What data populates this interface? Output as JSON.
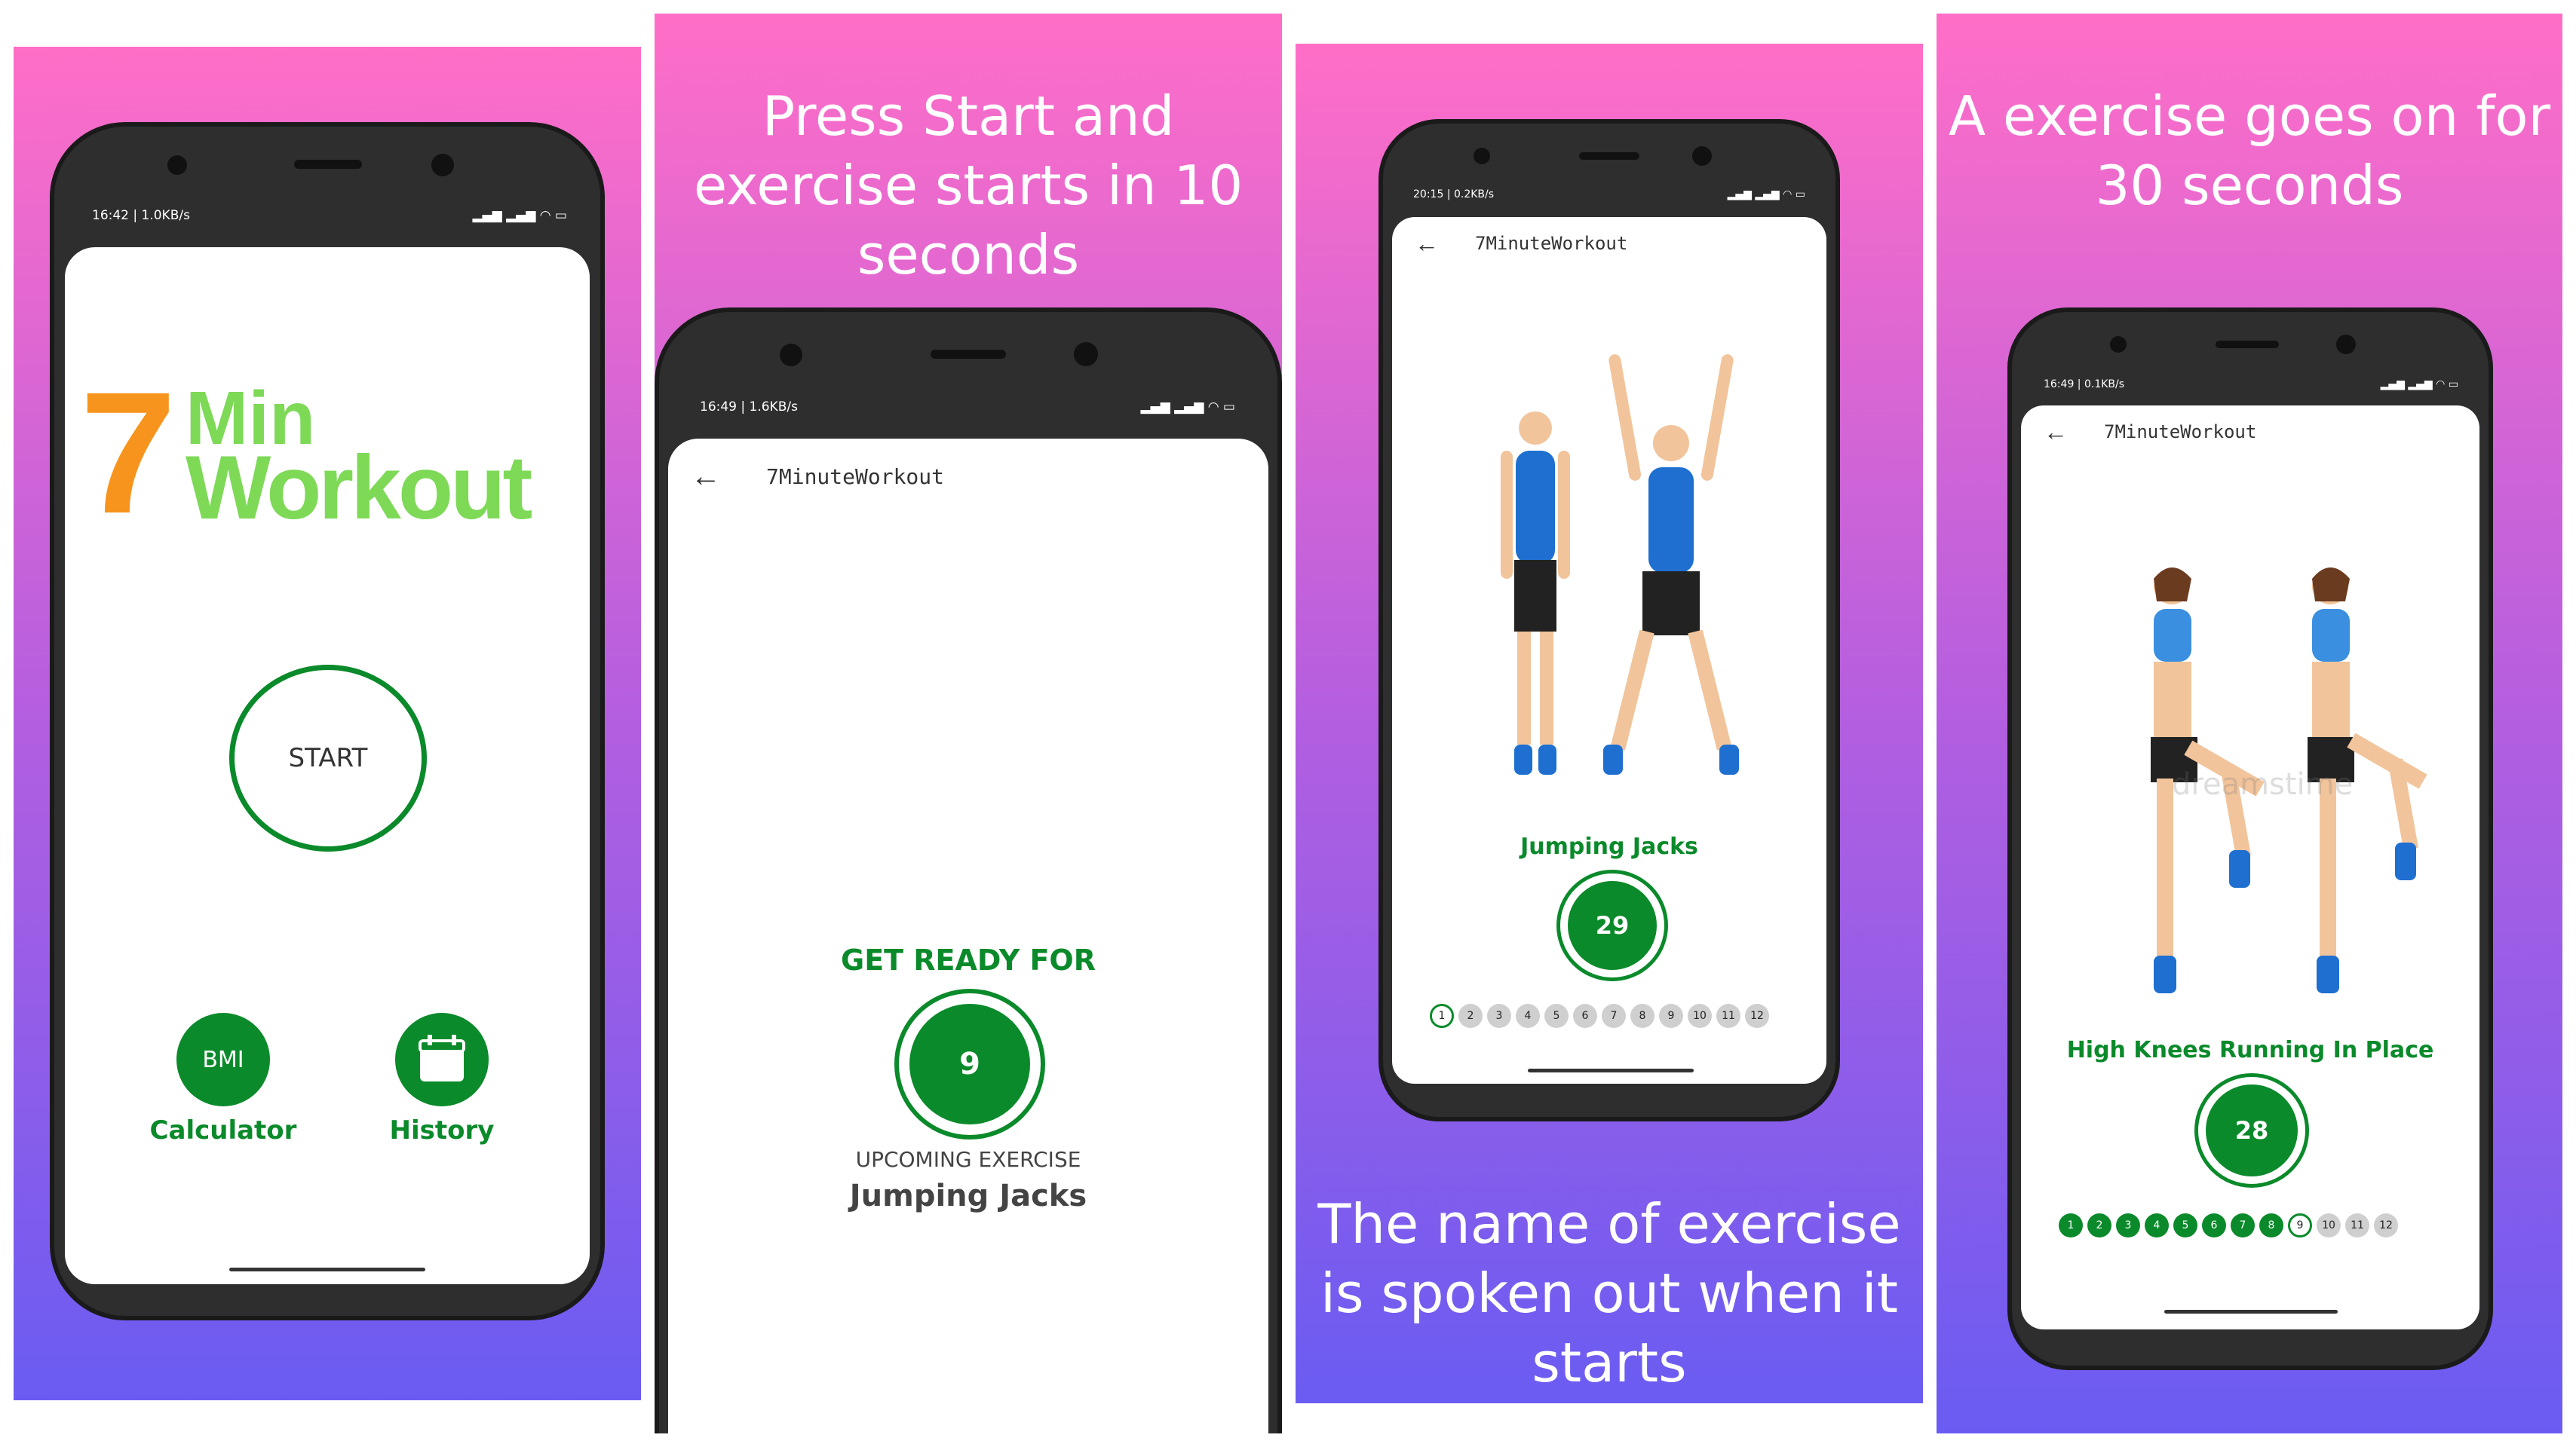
{
  "panel1": {
    "status_time": "16:42 | 1.0KB/s",
    "logo": {
      "seven": "7",
      "min": "Min",
      "workout": "Workout"
    },
    "start_label": "START",
    "bmi_label": "BMI",
    "calculator_label": "Calculator",
    "history_label": "History"
  },
  "panel2": {
    "caption": "Press Start and exercise starts in 10 seconds",
    "status_time": "16:49 | 1.6KB/s",
    "toolbar_title": "7MinuteWorkout",
    "get_ready": "GET READY FOR",
    "timer": "9",
    "upcoming_label": "UPCOMING EXERCISE",
    "upcoming_name": "Jumping Jacks"
  },
  "panel3": {
    "caption": "The name of exercise is spoken out when it starts",
    "status_time": "20:15 | 0.2KB/s",
    "toolbar_title": "7MinuteWorkout",
    "exercise_name": "Jumping Jacks",
    "timer": "29",
    "progress": [
      "1",
      "2",
      "3",
      "4",
      "5",
      "6",
      "7",
      "8",
      "9",
      "10",
      "11",
      "12"
    ]
  },
  "panel4": {
    "caption": "A exercise goes on for 30 seconds",
    "status_time": "16:49 | 0.1KB/s",
    "toolbar_title": "7MinuteWorkout",
    "exercise_name": "High Knees Running In Place",
    "timer": "28",
    "watermark": "dreamstime",
    "progress": [
      "1",
      "2",
      "3",
      "4",
      "5",
      "6",
      "7",
      "8",
      "9",
      "10",
      "11",
      "12"
    ]
  },
  "colors": {
    "accent_green": "#0a8a2a",
    "logo_orange": "#f7941d",
    "logo_green": "#7ed957"
  },
  "icons": {
    "back": "arrow-left-icon",
    "history": "calendar-icon"
  }
}
